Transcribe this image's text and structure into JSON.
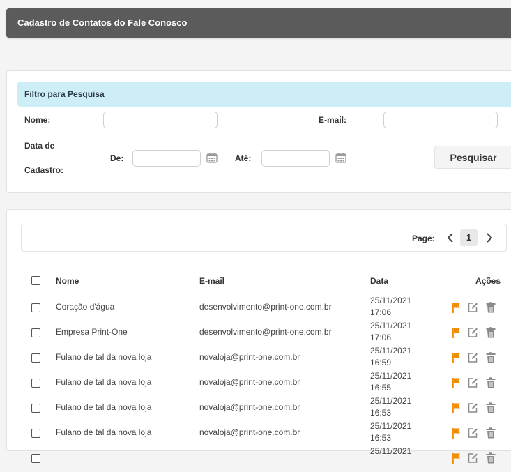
{
  "header": {
    "title": "Cadastro de Contatos do Fale Conosco"
  },
  "filter": {
    "title": "Filtro para Pesquisa",
    "name_label": "Nome:",
    "email_label": "E-mail:",
    "date_label_line1": "Data de",
    "date_label_line2": "Cadastro:",
    "from_label": "De:",
    "to_label": "Até:",
    "name_value": "",
    "email_value": "",
    "from_value": "",
    "to_value": "",
    "search_button": "Pesquisar"
  },
  "pagination": {
    "label": "Page:",
    "current": "1"
  },
  "table": {
    "columns": {
      "name": "Nome",
      "email": "E-mail",
      "date": "Data",
      "actions": "Ações"
    },
    "rows": [
      {
        "name": "Coração d'água",
        "email": "desenvolvimento@print-one.com.br",
        "date": "25/11/2021",
        "time": "17:06"
      },
      {
        "name": "Empresa Print-One",
        "email": "desenvolvimento@print-one.com.br",
        "date": "25/11/2021",
        "time": "17:06"
      },
      {
        "name": "Fulano de tal da nova loja",
        "email": "novaloja@print-one.com.br",
        "date": "25/11/2021",
        "time": "16:59"
      },
      {
        "name": "Fulano de tal da nova loja",
        "email": "novaloja@print-one.com.br",
        "date": "25/11/2021",
        "time": "16:55"
      },
      {
        "name": "Fulano de tal da nova loja",
        "email": "novaloja@print-one.com.br",
        "date": "25/11/2021",
        "time": "16:53"
      },
      {
        "name": "Fulano de tal da nova loja",
        "email": "novaloja@print-one.com.br",
        "date": "25/11/2021",
        "time": "16:53"
      },
      {
        "name": "",
        "email": "",
        "date": "25/11/2021",
        "time": ""
      }
    ]
  },
  "icons": {
    "flag": "flag-icon",
    "edit": "edit-icon",
    "delete": "trash-icon",
    "calendar": "calendar-icon"
  },
  "colors": {
    "header_bg": "#5b5b5b",
    "filter_head_bg": "#cdeef6",
    "flag": "#f08c00",
    "icon_gray": "#8a8a8a"
  }
}
